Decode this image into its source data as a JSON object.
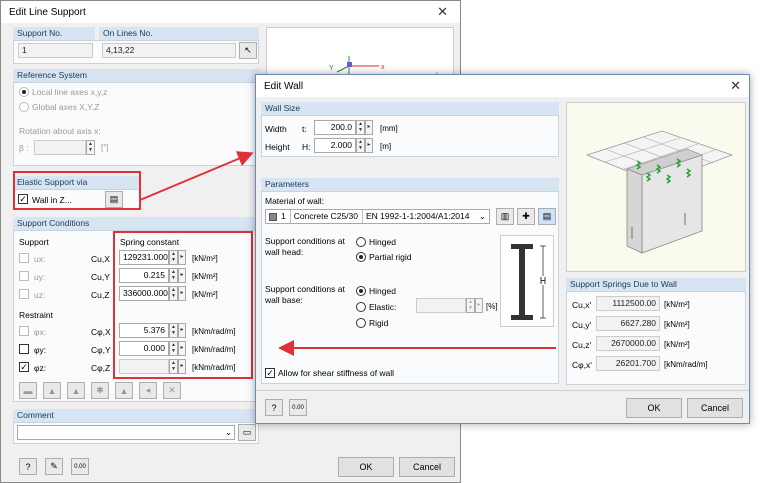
{
  "line_support": {
    "title": "Edit Line Support",
    "support_no_label": "Support No.",
    "support_no": "1",
    "on_lines_label": "On Lines No.",
    "on_lines": "4,13,22",
    "ref_system_header": "Reference System",
    "local_axes": "Local line axes x,y,z",
    "global_axes": "Global axes X,Y,Z",
    "rotation_label": "Rotation about axis x:",
    "beta_label": "β :",
    "beta_unit": "[°]",
    "elastic_header": "Elastic Support via",
    "wall_in_z": "Wall in Z...",
    "conditions_header": "Support Conditions",
    "support_label": "Support",
    "spring_constant_label": "Spring constant",
    "support_rows": [
      {
        "label": "ux:",
        "c": "Cu,X",
        "value": "129231.000",
        "unit": "[kN/m²]"
      },
      {
        "label": "uy:",
        "c": "Cu,Y",
        "value": "0.215",
        "unit": "[kN/m²]"
      },
      {
        "label": "uz:",
        "c": "Cu,Z",
        "value": "336000.000",
        "unit": "[kN/m²]"
      }
    ],
    "restraint_label": "Restraint",
    "restraint_rows": [
      {
        "label": "φx:",
        "c": "Cφ,X",
        "value": "5.376",
        "unit": "[kNm/rad/m]",
        "checked": false
      },
      {
        "label": "φy:",
        "c": "Cφ,Y",
        "value": "0.000",
        "unit": "[kNm/rad/m]",
        "checked": false
      },
      {
        "label": "φz:",
        "c": "Cφ,Z",
        "value": "",
        "unit": "[kNm/rad/m]",
        "checked": true
      }
    ],
    "comment_header": "Comment",
    "ok": "OK",
    "cancel": "Cancel"
  },
  "edit_wall": {
    "title": "Edit Wall",
    "wall_size_header": "Wall Size",
    "width_label": "Width",
    "width_sym": "t:",
    "width_value": "200.0",
    "width_unit": "[mm]",
    "height_label": "Height",
    "height_sym": "H:",
    "height_value": "2.000",
    "height_unit": "[m]",
    "parameters_header": "Parameters",
    "material_label": "Material of wall:",
    "material_no": "1",
    "material_name": "Concrete C25/30",
    "material_norm": "EN 1992-1-1:2004/A1:2014",
    "head_label_1": "Support conditions at",
    "head_label_2": "wall head:",
    "head_hinged": "Hinged",
    "head_partial": "Partial rigid",
    "base_label_1": "Support conditions at",
    "base_label_2": "wall base:",
    "base_hinged": "Hinged",
    "base_elastic": "Elastic:",
    "base_elastic_unit": "[%]",
    "base_rigid": "Rigid",
    "shear_label": "Allow for shear stiffness of wall",
    "springs_header": "Support Springs Due to Wall",
    "springs": [
      {
        "c": "Cu,x'",
        "value": "1112500.00",
        "unit": "[kN/m²]"
      },
      {
        "c": "Cu,y'",
        "value": "6627.280",
        "unit": "[kN/m²]"
      },
      {
        "c": "Cu,z'",
        "value": "2670000.00",
        "unit": "[kN/m²]"
      },
      {
        "c": "Cφ,x'",
        "value": "26201.700",
        "unit": "[kNm/rad/m]"
      }
    ],
    "ok": "OK",
    "cancel": "Cancel"
  },
  "preview_axes": {
    "x": "x",
    "y": "Y"
  },
  "accent_red": "#e0303a"
}
